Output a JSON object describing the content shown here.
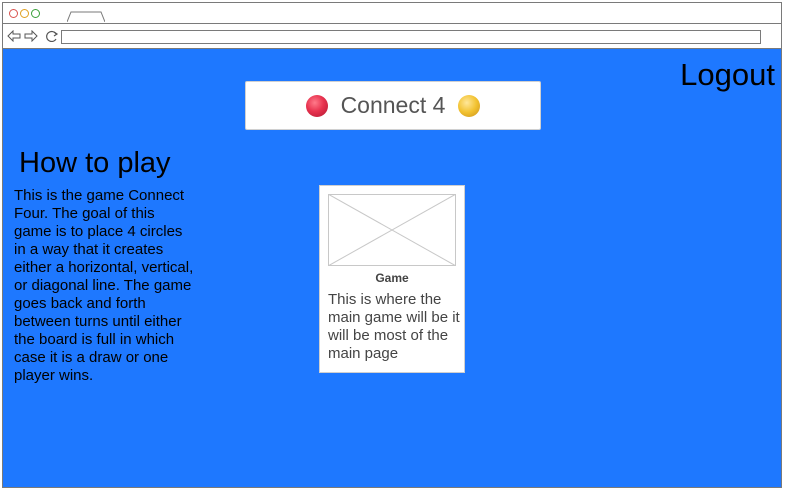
{
  "header": {
    "title": "Connect 4",
    "logout_label": "Logout"
  },
  "howto": {
    "title": "How to play",
    "text": "This is the game Connect Four. The goal of this game is to place 4 circles in a way that it creates either a horizontal, vertical, or diagonal line. The game goes back and forth between turns until either the board is full in which case it is a draw or one player wins."
  },
  "game_card": {
    "label": "Game",
    "text": "This is where the main game will be it will be most of the main page"
  },
  "colors": {
    "background": "#1e78ff",
    "red_piece": "#e8334f",
    "yellow_piece": "#f2c230"
  }
}
